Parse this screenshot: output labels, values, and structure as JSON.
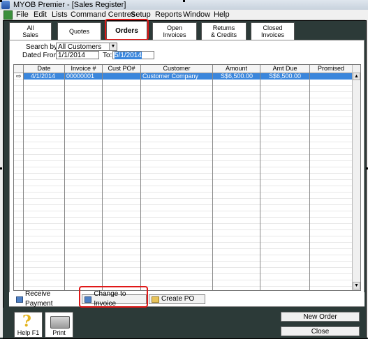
{
  "window": {
    "title": "MYOB Premier - [Sales Register]"
  },
  "menu": [
    "File",
    "Edit",
    "Lists",
    "Command Centres",
    "Setup",
    "Reports",
    "Window",
    "Help"
  ],
  "tabs": [
    {
      "line1": "All",
      "line2": "Sales"
    },
    {
      "line1": "Quotes",
      "line2": ""
    },
    {
      "line1": "Orders",
      "line2": ""
    },
    {
      "line1": "Open",
      "line2": "Invoices"
    },
    {
      "line1": "Returns",
      "line2": "& Credits"
    },
    {
      "line1": "Closed",
      "line2": "Invoices"
    }
  ],
  "filters": {
    "search_by_label": "Search by:",
    "search_by_value": "All Customers",
    "dated_from_label": "Dated From:",
    "dated_from_value": "1/1/2014",
    "to_label": "To:",
    "to_value": "5/1/2014"
  },
  "grid": {
    "columns": [
      "Date",
      "Invoice #",
      "Cust PO#",
      "Customer",
      "Amount",
      "Amt Due",
      "Promised"
    ],
    "rows": [
      {
        "date": "4/1/2014",
        "invoice": "00000001",
        "cust_po": "",
        "customer": "Customer Company",
        "amount": "S$6,500.00",
        "amt_due": "S$6,500.00",
        "promised": ""
      }
    ]
  },
  "actions": {
    "receive_payment": "Receive Payment",
    "change_to_invoice": "Change to Invoice",
    "create_po": "Create PO"
  },
  "footer": {
    "help": "Help F1",
    "print": "Print",
    "new_order": "New Order",
    "close": "Close"
  }
}
